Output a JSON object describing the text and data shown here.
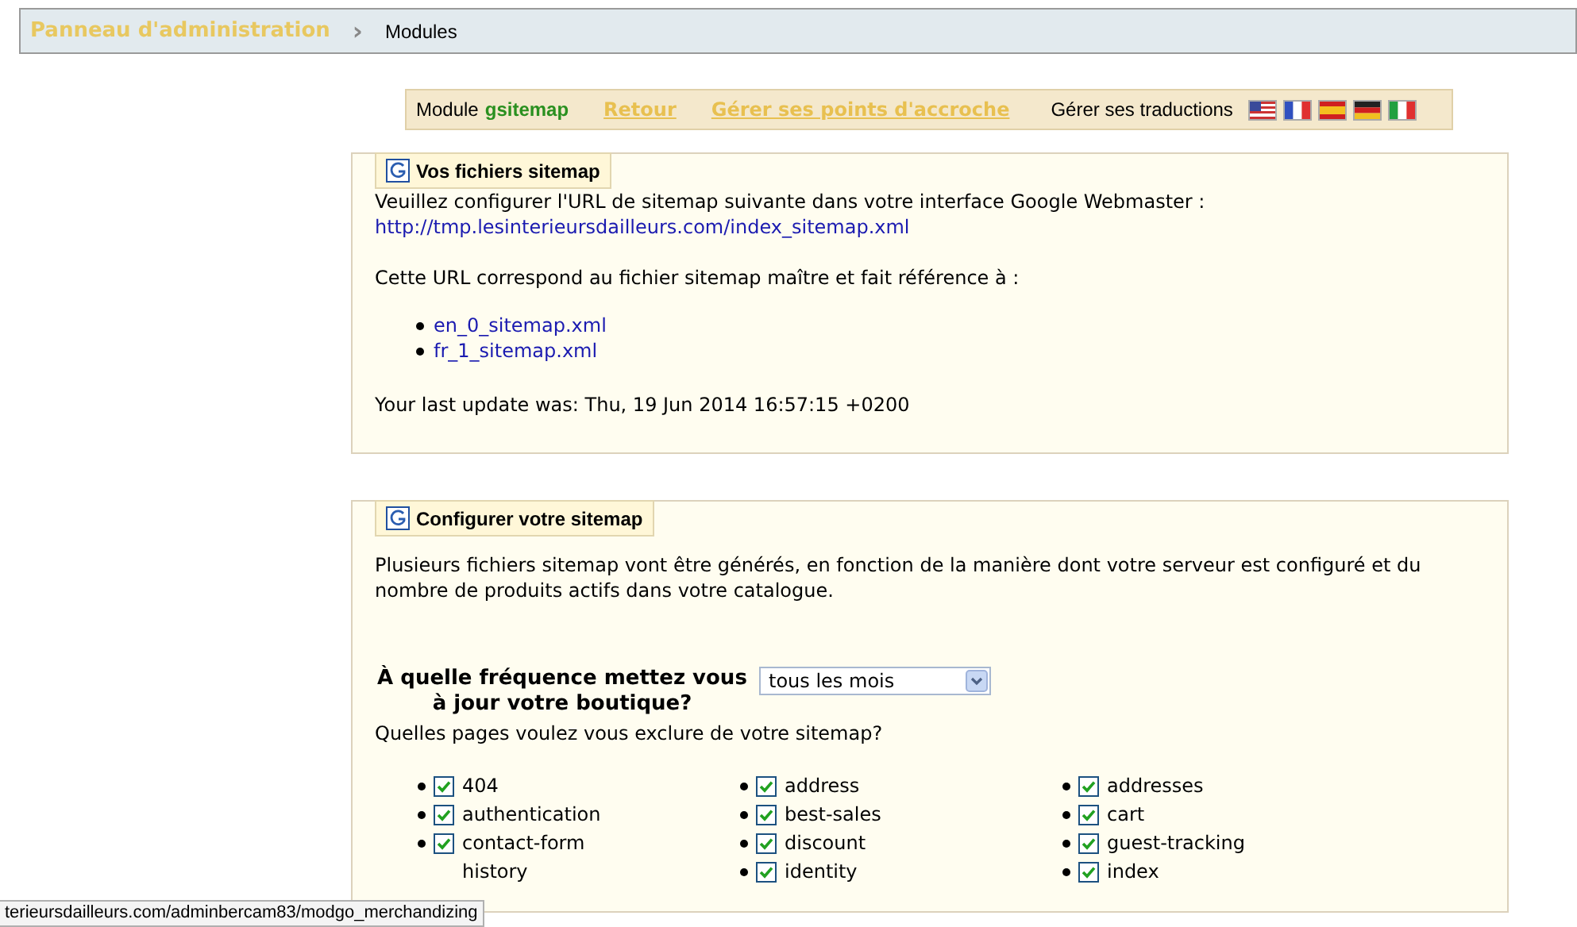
{
  "breadcrumb": {
    "root": "Panneau d'administration",
    "separator": "›",
    "current": "Modules"
  },
  "toolbar": {
    "module_label": "Module",
    "module_name": "gsitemap",
    "links": [
      "Retour",
      "Gérer ses points d'accroche"
    ],
    "translations_label": "Gérer ses traductions",
    "flags": [
      {
        "kind": "us"
      },
      {
        "kind": "fr"
      },
      {
        "kind": "es"
      },
      {
        "kind": "de"
      },
      {
        "kind": "it"
      }
    ]
  },
  "files_panel": {
    "legend": "Vos fichiers sitemap",
    "intro": "Veuillez configurer l'URL de sitemap suivante dans votre interface Google Webmaster :",
    "url": "http://tmp.lesinterieursdailleurs.com/index_sitemap.xml",
    "refers": "Cette URL correspond au fichier sitemap maître et fait référence à :",
    "files": [
      "en_0_sitemap.xml",
      "fr_1_sitemap.xml"
    ],
    "last_update": "Your last update was: Thu, 19 Jun 2014 16:57:15 +0200"
  },
  "config_panel": {
    "legend": "Configurer votre sitemap",
    "intro": "Plusieurs fichiers sitemap vont être générés, en fonction de la manière dont votre serveur est configuré et du nombre de produits actifs dans votre catalogue.",
    "frequency_label": "À quelle fréquence mettez vous à jour votre boutique?",
    "frequency_value": "tous les mois",
    "exclude_label": "Quelles pages voulez vous exclure de votre sitemap?",
    "pages": [
      [
        {
          "label": "404",
          "checked": true
        },
        {
          "label": "authentication",
          "checked": true
        },
        {
          "label": "contact-form",
          "checked": true
        },
        {
          "label": "history"
        }
      ],
      [
        {
          "label": "address",
          "checked": true
        },
        {
          "label": "best-sales",
          "checked": true
        },
        {
          "label": "discount",
          "checked": true
        },
        {
          "label": "identity",
          "checked": true
        }
      ],
      [
        {
          "label": "addresses",
          "checked": true
        },
        {
          "label": "cart",
          "checked": true
        },
        {
          "label": "guest-tracking",
          "checked": true
        },
        {
          "label": "index",
          "checked": true
        }
      ]
    ]
  },
  "status_bar": {
    "url": "terieursdailleurs.com/adminbercam83/modgo_merchandizing"
  }
}
